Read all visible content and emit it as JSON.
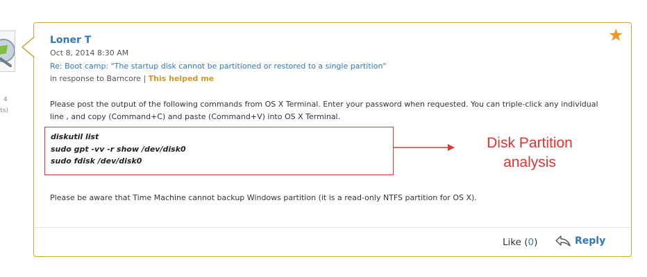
{
  "side": {
    "count": "4",
    "points": "ints)"
  },
  "post": {
    "author": "Loner T",
    "date": "Oct 8, 2014 8:30 AM",
    "thread_link": "Re: Boot camp: \"The startup disk cannot be partitioned or restored to a single partition\"",
    "in_response_prefix": "in response to Barncore",
    "separator": "|",
    "helped_label": "This helped me",
    "body_paragraph_1": "Please post the output of the following commands from OS X Terminal. Enter your password when requested. You can triple-click any individual line , and copy (Command+C) and paste (Command+V) into OS X Terminal.",
    "commands": [
      "diskutil list",
      "sudo gpt -vv -r show /dev/disk0",
      "sudo fdisk /dev/disk0"
    ],
    "body_paragraph_2": "Please be aware that Time Machine cannot backup Windows partition (it is a read-only NTFS partition for OS X)."
  },
  "annotation": {
    "line1": "Disk Partition",
    "line2": "analysis",
    "color": "#e8322e"
  },
  "actions": {
    "like_label": "Like (",
    "like_count": "0",
    "like_close": ")",
    "reply_label": "Reply"
  },
  "icons": {
    "star": "star-icon",
    "reply": "reply-arrow-icon",
    "avatar": "avatar-image"
  },
  "colors": {
    "accent": "#2f78c4",
    "border": "#d5a33a",
    "star": "#f29822",
    "helped": "#d19728"
  }
}
